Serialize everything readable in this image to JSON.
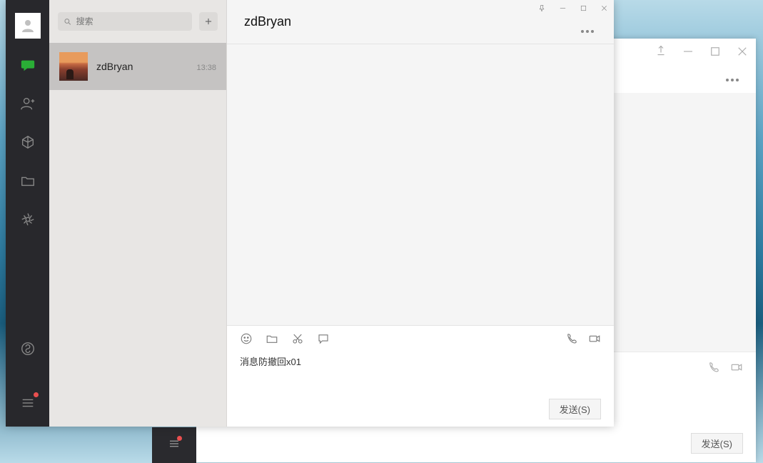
{
  "search": {
    "placeholder": "搜索"
  },
  "contacts": [
    {
      "name": "zdBryan",
      "time": "13:38"
    }
  ],
  "chat": {
    "title": "zdBryan",
    "input_text": "消息防撤回x01",
    "send_label": "发送(S)"
  },
  "bg_window": {
    "send_label": "发送(S)"
  },
  "sidebar": {
    "items": [
      "chat",
      "contacts",
      "mini-program",
      "files",
      "settings"
    ]
  }
}
